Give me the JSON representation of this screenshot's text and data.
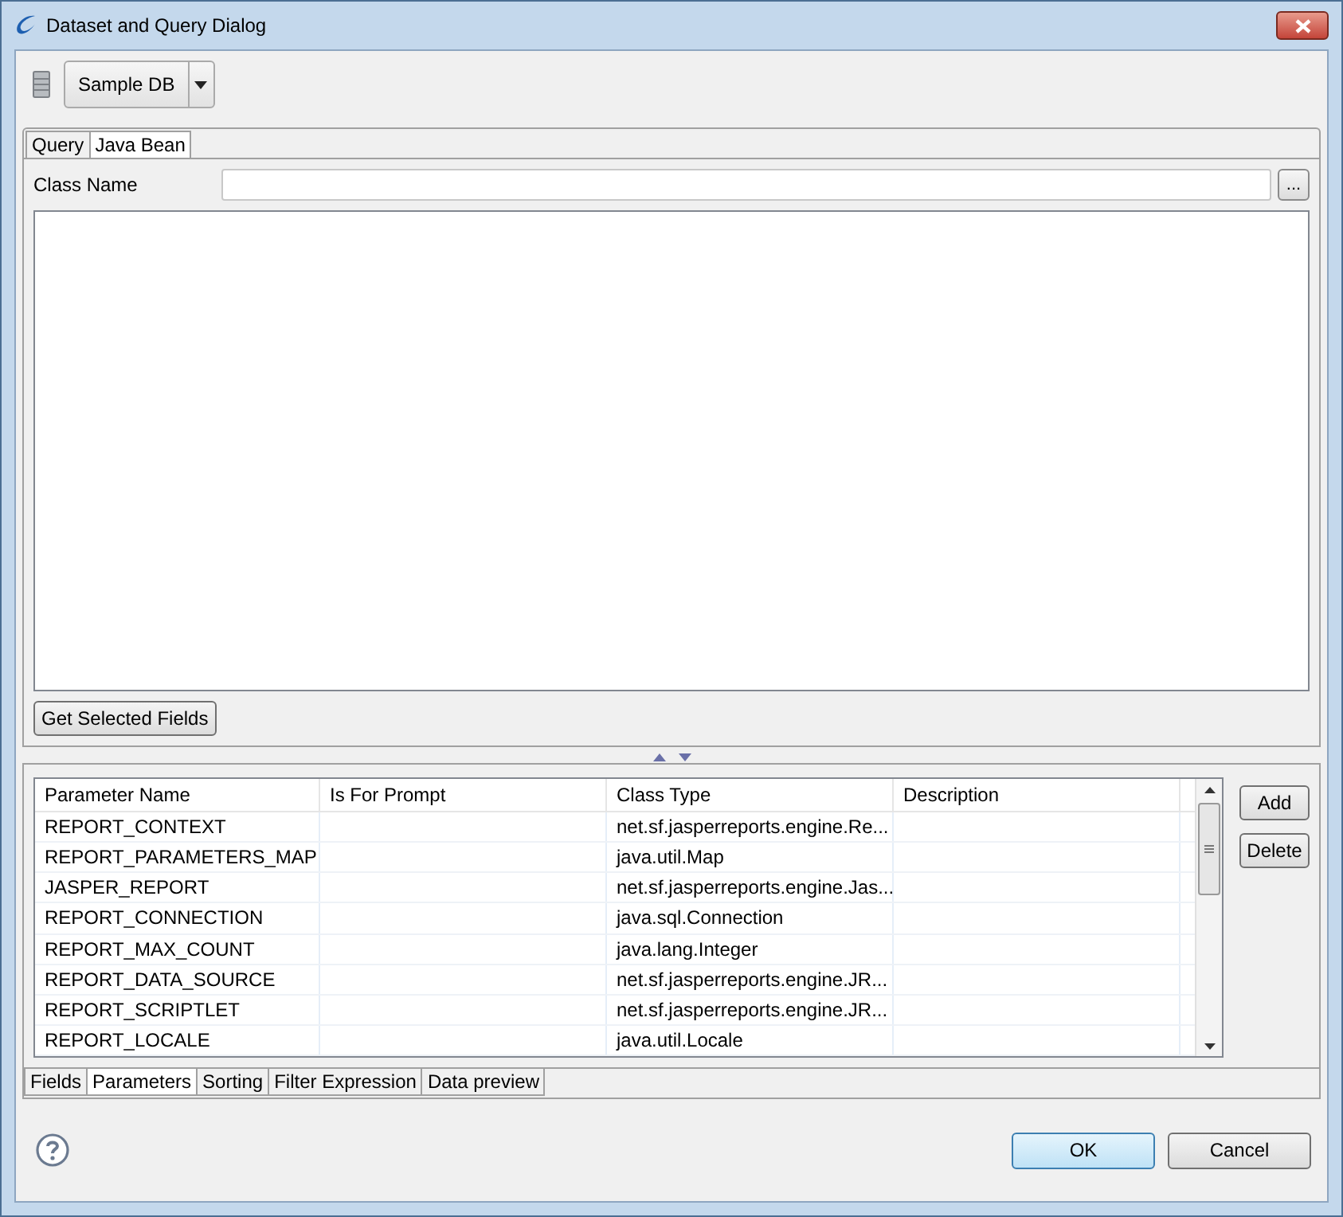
{
  "window": {
    "title": "Dataset and Query Dialog"
  },
  "data_source": {
    "label": "Sample DB"
  },
  "query_tabs": [
    {
      "label": "Query",
      "selected": false
    },
    {
      "label": "Java Bean",
      "selected": true
    }
  ],
  "class_name": {
    "label": "Class Name",
    "browse": "..."
  },
  "get_fields_button": "Get Selected Fields",
  "parameters": {
    "columns": [
      "Parameter Name",
      "Is For Prompt",
      "Class Type",
      "Description"
    ],
    "rows": [
      [
        "REPORT_CONTEXT",
        "",
        "net.sf.jasperreports.engine.Re...",
        ""
      ],
      [
        "REPORT_PARAMETERS_MAP",
        "",
        "java.util.Map",
        ""
      ],
      [
        "JASPER_REPORT",
        "",
        "net.sf.jasperreports.engine.Jas...",
        ""
      ],
      [
        "REPORT_CONNECTION",
        "",
        "java.sql.Connection",
        ""
      ],
      [
        "REPORT_MAX_COUNT",
        "",
        "java.lang.Integer",
        ""
      ],
      [
        "REPORT_DATA_SOURCE",
        "",
        "net.sf.jasperreports.engine.JR...",
        ""
      ],
      [
        "REPORT_SCRIPTLET",
        "",
        "net.sf.jasperreports.engine.JR...",
        ""
      ],
      [
        "REPORT_LOCALE",
        "",
        "java.util.Locale",
        ""
      ]
    ],
    "buttons": [
      "Add",
      "Delete"
    ]
  },
  "bottom_tabs": [
    {
      "label": "Fields",
      "selected": false
    },
    {
      "label": "Parameters",
      "selected": true
    },
    {
      "label": "Sorting",
      "selected": false
    },
    {
      "label": "Filter Expression",
      "selected": false
    },
    {
      "label": "Data preview",
      "selected": false
    }
  ],
  "dialog_buttons": [
    {
      "label": "OK",
      "default": true
    },
    {
      "label": "Cancel",
      "default": false
    }
  ]
}
